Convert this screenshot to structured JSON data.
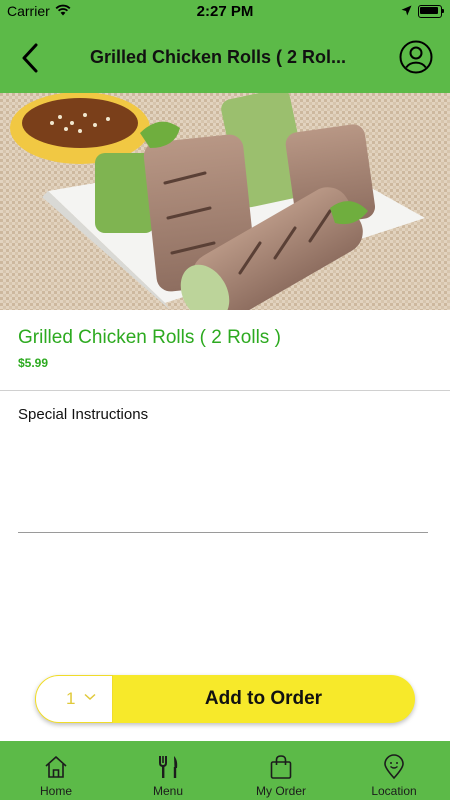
{
  "status_bar": {
    "carrier": "Carrier",
    "time": "2:27 PM"
  },
  "header": {
    "title": "Grilled Chicken Rolls ( 2 Rol..."
  },
  "item": {
    "name": "Grilled Chicken Rolls ( 2 Rolls )",
    "price": "$5.99"
  },
  "special_instructions": {
    "label": "Special Instructions",
    "value": ""
  },
  "order": {
    "quantity": "1",
    "add_label": "Add to Order"
  },
  "tabs": [
    {
      "label": "Home",
      "icon": "home-icon"
    },
    {
      "label": "Menu",
      "icon": "fork-knife-icon"
    },
    {
      "label": "My Order",
      "icon": "shopping-bag-icon"
    },
    {
      "label": "Location",
      "icon": "location-pin-icon"
    }
  ],
  "colors": {
    "brand_green": "#5cba48",
    "item_green": "#2daa20",
    "accent_yellow": "#f7e92a"
  }
}
